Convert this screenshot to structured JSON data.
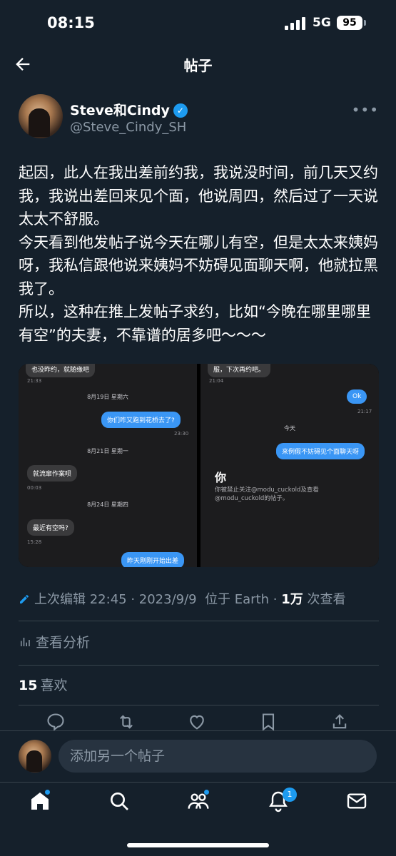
{
  "status_bar": {
    "time": "08:15",
    "network": "5G",
    "battery": "95"
  },
  "header": {
    "title": "帖子"
  },
  "post": {
    "author_name": "Steve和Cindy",
    "author_handle": "@Steve_Cindy_SH",
    "text": "起因，此人在我出差前约我，我说没时间，前几天又约我，我说出差回来见个面，他说周四，然后过了一天说太太不舒服。\n今天看到他发帖子说今天在哪儿有空，但是太太来姨妈呀，我私信跟他说来姨妈不妨碍见面聊天啊，他就拉黑我了。\n所以，这种在推上发帖子求约，比如“今晚在哪里哪里有空”的夫妻，不靠谱的居多吧～～～",
    "meta": {
      "edited": "上次编辑 22:45 · 2023/9/9",
      "location": "位于 Earth",
      "views_count": "1万",
      "views_label": "次查看"
    },
    "analytics_label": "查看分析",
    "likes_count": "15",
    "likes_label": "喜欢"
  },
  "screenshot": {
    "left": {
      "top_partial": "也没昨约，就随缘吧",
      "top_ts": "21:33",
      "date1": "8月19日 星期六",
      "msg1": "你们咋又跑到花桥去了?",
      "msg1_ts": "23:30",
      "date2": "8月21日 星期一",
      "msg2": "就流窜作案呗",
      "msg2_ts": "00:03",
      "date3": "8月24日 星期四",
      "msg3": "最近有空吗?",
      "msg3_ts": "15:28",
      "msg4": "昨天刚刚开始出差"
    },
    "right": {
      "top_partial": "服，下次再约吧。",
      "top_ts": "21:04",
      "msg1": "Ok",
      "msg1_ts": "21:17",
      "date1": "今天",
      "msg2": "来例假不妨碍见个面聊天呀",
      "you_label": "你",
      "blocked_line1": "你被禁止关注@modu_cuckold及查看",
      "blocked_line2": "@modu_cuckold的帖子。"
    }
  },
  "reply": {
    "placeholder": "添加另一个帖子"
  },
  "tabbar": {
    "notifications_badge": "1"
  },
  "colors": {
    "background": "#15202b",
    "accent": "#1d9bf0",
    "text_secondary": "#8b98a5",
    "divider": "#38444d"
  }
}
